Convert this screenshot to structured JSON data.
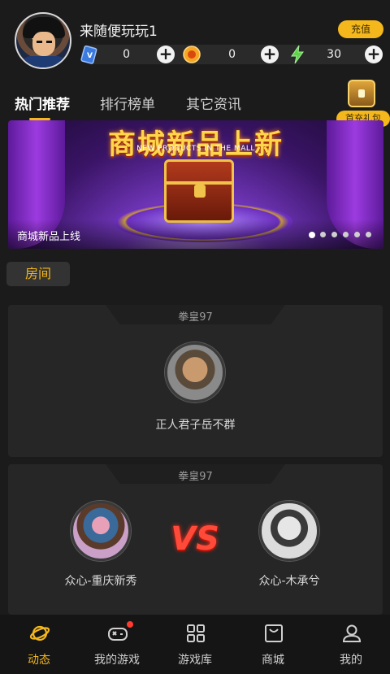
{
  "user": {
    "name": "来随便玩玩1",
    "recharge_label": "充值"
  },
  "currency": [
    {
      "icon": "card-icon",
      "value": "0"
    },
    {
      "icon": "coin-icon",
      "value": "0"
    },
    {
      "icon": "energy-icon",
      "value": "30"
    }
  ],
  "tabs": [
    {
      "label": "热门推荐",
      "active": true
    },
    {
      "label": "排行榜单",
      "active": false
    },
    {
      "label": "其它资讯",
      "active": false
    }
  ],
  "gift": {
    "label": "首充礼包",
    "icon": "treasure-chest-icon"
  },
  "banner": {
    "title": "商城新品上新",
    "subtitle": "NEW PRODUCTS IN THE MALL",
    "caption": "商城新品上线",
    "dots": 6,
    "active_dot": 0
  },
  "section": {
    "label": "房间"
  },
  "rooms": [
    {
      "game": "拳皇97",
      "players": [
        {
          "name": "正人君子岳不群"
        }
      ]
    },
    {
      "game": "拳皇97",
      "players": [
        {
          "name": "众心-重庆新秀"
        },
        {
          "name": "众心-木承兮"
        }
      ],
      "vs": "VS"
    }
  ],
  "nav": [
    {
      "label": "动态",
      "icon": "planet-icon",
      "active": true
    },
    {
      "label": "我的游戏",
      "icon": "gamepad-icon",
      "active": false,
      "badge": true
    },
    {
      "label": "游戏库",
      "icon": "grid-icon",
      "active": false
    },
    {
      "label": "商城",
      "icon": "shopping-bag-icon",
      "active": false
    },
    {
      "label": "我的",
      "icon": "user-icon",
      "active": false
    }
  ],
  "colors": {
    "accent": "#f4b81c",
    "background": "#1b1b1b",
    "card": "#262626",
    "vs": "#ff4a3a"
  }
}
